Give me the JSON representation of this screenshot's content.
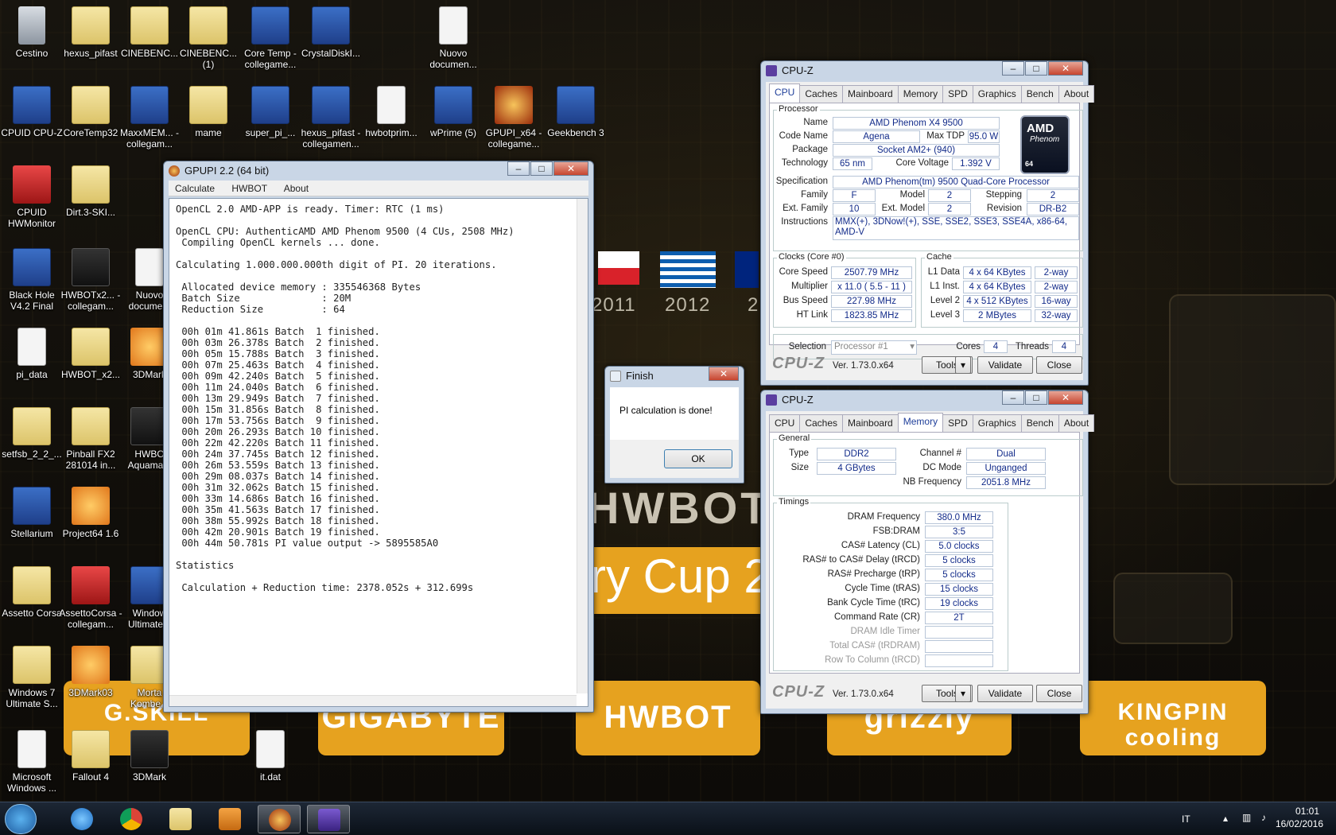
{
  "desktop_icons": [
    {
      "label": "Cestino",
      "type": "bin"
    },
    {
      "label": "hexus_pifast",
      "type": "folder"
    },
    {
      "label": "CINEBENC...",
      "type": "folder"
    },
    {
      "label": "CINEBENC... (1)",
      "type": "folder"
    },
    {
      "label": "Core Temp - collegame...",
      "type": "app"
    },
    {
      "label": "CrystalDiskI...",
      "type": "app"
    },
    {
      "label": "Nuovo documen...",
      "type": "file"
    },
    {
      "label": "CPUID CPU-Z",
      "type": "app"
    },
    {
      "label": "CoreTemp32",
      "type": "folder"
    },
    {
      "label": "MaxxMEM... - collegam...",
      "type": "app"
    },
    {
      "label": "mame",
      "type": "folder"
    },
    {
      "label": "super_pi_...",
      "type": "app"
    },
    {
      "label": "hexus_pifast - collegamen...",
      "type": "app"
    },
    {
      "label": "hwbotprim...",
      "type": "file"
    },
    {
      "label": "wPrime (5)",
      "type": "app"
    },
    {
      "label": "GPUPI_x64 - collegame...",
      "type": "pi"
    },
    {
      "label": "Geekbench 3",
      "type": "app"
    },
    {
      "label": "CPUID HWMonitor",
      "type": "red"
    },
    {
      "label": "Dirt.3-SKI...",
      "type": "folder"
    },
    {
      "label": "Black Hole V4.2 Final",
      "type": "app"
    },
    {
      "label": "HWBOTx2... - collegam...",
      "type": "dark"
    },
    {
      "label": "Nuovo docume...",
      "type": "file"
    },
    {
      "label": "pi_data",
      "type": "file"
    },
    {
      "label": "HWBOT_x2...",
      "type": "folder"
    },
    {
      "label": "3DMark",
      "type": "orange"
    },
    {
      "label": "setfsb_2_2_...",
      "type": "folder"
    },
    {
      "label": "Pinball FX2 281014 in...",
      "type": "folder"
    },
    {
      "label": "HWBO Aquama...",
      "type": "dark"
    },
    {
      "label": "Stellarium",
      "type": "app"
    },
    {
      "label": "Project64 1.6",
      "type": "orange"
    },
    {
      "label": "Assetto Corsa",
      "type": "folder"
    },
    {
      "label": "AssettoCorsa - collegam...",
      "type": "red"
    },
    {
      "label": "Window Ultimate...",
      "type": "app"
    },
    {
      "label": "Windows 7 Ultimate S...",
      "type": "folder"
    },
    {
      "label": "3DMark03",
      "type": "orange"
    },
    {
      "label": "Morta Kombe...",
      "type": "folder"
    },
    {
      "label": "Microsoft Windows ...",
      "type": "file"
    },
    {
      "label": "Fallout 4",
      "type": "folder"
    },
    {
      "label": "3DMark",
      "type": "dark"
    },
    {
      "label": "it.dat",
      "type": "file"
    }
  ],
  "wallpaper": {
    "years": [
      "2011",
      "2012",
      "2"
    ],
    "brand_text": "HWBOT",
    "cup_text": "ry Cup 2",
    "sponsors": [
      "G.SKILL",
      "GIGABYTE",
      "HWBOT",
      "grizzly",
      "KINGPIN cooling"
    ]
  },
  "gpupi": {
    "title": "GPUPI 2.2 (64 bit)",
    "menu": [
      "Calculate",
      "HWBOT",
      "About"
    ],
    "log_lines": [
      "OpenCL 2.0 AMD-APP is ready. Timer: RTC (1 ms)",
      "",
      "OpenCL CPU: AuthenticAMD AMD Phenom 9500 (4 CUs, 2508 MHz)",
      " Compiling OpenCL kernels ... done.",
      "",
      "Calculating 1.000.000.000th digit of PI. 20 iterations.",
      "",
      " Allocated device memory : 335546368 Bytes",
      " Batch Size              : 20M",
      " Reduction Size          : 64",
      "",
      " 00h 01m 41.861s Batch  1 finished.",
      " 00h 03m 26.378s Batch  2 finished.",
      " 00h 05m 15.788s Batch  3 finished.",
      " 00h 07m 25.463s Batch  4 finished.",
      " 00h 09m 42.240s Batch  5 finished.",
      " 00h 11m 24.040s Batch  6 finished.",
      " 00h 13m 29.949s Batch  7 finished.",
      " 00h 15m 31.856s Batch  8 finished.",
      " 00h 17m 53.756s Batch  9 finished.",
      " 00h 20m 26.293s Batch 10 finished.",
      " 00h 22m 42.220s Batch 11 finished.",
      " 00h 24m 37.745s Batch 12 finished.",
      " 00h 26m 53.559s Batch 13 finished.",
      " 00h 29m 08.037s Batch 14 finished.",
      " 00h 31m 32.062s Batch 15 finished.",
      " 00h 33m 14.686s Batch 16 finished.",
      " 00h 35m 41.563s Batch 17 finished.",
      " 00h 38m 55.992s Batch 18 finished.",
      " 00h 42m 20.901s Batch 19 finished.",
      " 00h 44m 50.781s PI value output -> 5895585A0",
      "",
      "Statistics",
      "",
      " Calculation + Reduction time: 2378.052s + 312.699s"
    ]
  },
  "finish": {
    "title": "Finish",
    "message": "PI calculation is done!",
    "ok": "OK"
  },
  "cpuz_cpu": {
    "title": "CPU-Z",
    "tabs": [
      "CPU",
      "Caches",
      "Mainboard",
      "Memory",
      "SPD",
      "Graphics",
      "Bench",
      "About"
    ],
    "active_tab": "CPU",
    "processor_label": "Processor",
    "name_label": "Name",
    "name": "AMD Phenom X4 9500",
    "codename_label": "Code Name",
    "codename": "Agena",
    "maxtdp_label": "Max TDP",
    "maxtdp": "95.0 W",
    "package_label": "Package",
    "package": "Socket AM2+ (940)",
    "technology_label": "Technology",
    "technology": "65 nm",
    "corevoltage_label": "Core Voltage",
    "corevoltage": "1.392 V",
    "spec_label": "Specification",
    "spec": "AMD Phenom(tm) 9500 Quad-Core Processor",
    "family_label": "Family",
    "family": "F",
    "model_label": "Model",
    "model": "2",
    "stepping_label": "Stepping",
    "stepping": "2",
    "extfamily_label": "Ext. Family",
    "extfamily": "10",
    "extmodel_label": "Ext. Model",
    "extmodel": "2",
    "revision_label": "Revision",
    "revision": "DR-B2",
    "instr_label": "Instructions",
    "instructions": "MMX(+), 3DNow!(+), SSE, SSE2, SSE3, SSE4A, x86-64, AMD-V",
    "clocks_label": "Clocks (Core #0)",
    "corespeed_label": "Core Speed",
    "corespeed": "2507.79 MHz",
    "multiplier_label": "Multiplier",
    "multiplier": "x 11.0 ( 5.5 - 11 )",
    "busspeed_label": "Bus Speed",
    "busspeed": "227.98 MHz",
    "htlink_label": "HT Link",
    "htlink": "1823.85 MHz",
    "cache_label": "Cache",
    "l1d_label": "L1 Data",
    "l1d": "4 x 64 KBytes",
    "l1d_way": "2-way",
    "l1i_label": "L1 Inst.",
    "l1i": "4 x 64 KBytes",
    "l1i_way": "2-way",
    "l2_label": "Level 2",
    "l2": "4 x 512 KBytes",
    "l2_way": "16-way",
    "l3_label": "Level 3",
    "l3": "2 MBytes",
    "l3_way": "32-way",
    "selection_label": "Selection",
    "selection": "Processor #1",
    "cores_label": "Cores",
    "cores": "4",
    "threads_label": "Threads",
    "threads": "4",
    "logo_text": "CPU-Z",
    "version": "Ver. 1.73.0.x64",
    "tools": "Tools",
    "validate": "Validate",
    "close": "Close",
    "amd_logo": {
      "brand": "AMD",
      "sub": "Phenom",
      "num": "64"
    }
  },
  "cpuz_mem": {
    "title": "CPU-Z",
    "tabs": [
      "CPU",
      "Caches",
      "Mainboard",
      "Memory",
      "SPD",
      "Graphics",
      "Bench",
      "About"
    ],
    "active_tab": "Memory",
    "general_label": "General",
    "type_label": "Type",
    "type": "DDR2",
    "size_label": "Size",
    "size": "4 GBytes",
    "channel_label": "Channel #",
    "channel": "Dual",
    "dcmode_label": "DC Mode",
    "dcmode": "Unganged",
    "nbfreq_label": "NB Frequency",
    "nbfreq": "2051.8 MHz",
    "timings_label": "Timings",
    "timings": [
      {
        "label": "DRAM Frequency",
        "value": "380.0 MHz",
        "active": true
      },
      {
        "label": "FSB:DRAM",
        "value": "3:5",
        "active": true
      },
      {
        "label": "CAS# Latency (CL)",
        "value": "5.0 clocks",
        "active": true
      },
      {
        "label": "RAS# to CAS# Delay (tRCD)",
        "value": "5 clocks",
        "active": true
      },
      {
        "label": "RAS# Precharge (tRP)",
        "value": "5 clocks",
        "active": true
      },
      {
        "label": "Cycle Time (tRAS)",
        "value": "15 clocks",
        "active": true
      },
      {
        "label": "Bank Cycle Time (tRC)",
        "value": "19 clocks",
        "active": true
      },
      {
        "label": "Command Rate (CR)",
        "value": "2T",
        "active": true
      },
      {
        "label": "DRAM Idle Timer",
        "value": "",
        "active": false
      },
      {
        "label": "Total CAS# (tRDRAM)",
        "value": "",
        "active": false
      },
      {
        "label": "Row To Column (tRCD)",
        "value": "",
        "active": false
      }
    ],
    "logo_text": "CPU-Z",
    "version": "Ver. 1.73.0.x64",
    "tools": "Tools",
    "validate": "Validate",
    "close": "Close"
  },
  "taskbar": {
    "lang": "IT",
    "time": "01:01",
    "date": "16/02/2016"
  },
  "colors": {
    "accent_orange": "#e6a21f",
    "cpuz_value_blue": "#122b8a"
  }
}
